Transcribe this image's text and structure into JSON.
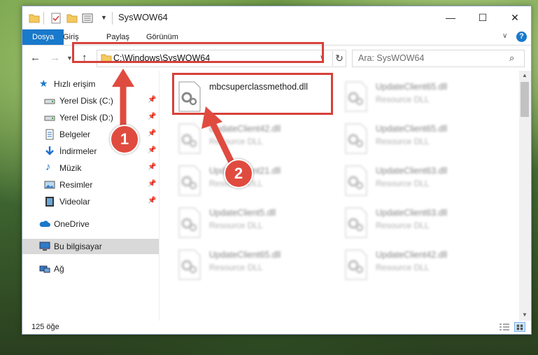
{
  "window": {
    "title": "SysWOW64",
    "minimize_glyph": "—",
    "maximize_glyph": "☐",
    "close_glyph": "✕"
  },
  "ribbon": {
    "tabs": [
      "Dosya",
      "Giriş",
      "Paylaş",
      "Görünüm"
    ],
    "help_glyph": "?"
  },
  "address": {
    "path": "C:\\Windows\\SysWOW64",
    "search_placeholder": "Ara: SysWOW64"
  },
  "nav_pane": {
    "items": [
      {
        "label": "Hızlı erişim",
        "icon": "star-icon",
        "pinned": false
      },
      {
        "label": "Yerel Disk (C:)",
        "icon": "drive-icon",
        "pinned": true
      },
      {
        "label": "Yerel Disk (D:)",
        "icon": "drive-icon",
        "pinned": true
      },
      {
        "label": "Belgeler",
        "icon": "documents-icon",
        "pinned": true
      },
      {
        "label": "İndirmeler",
        "icon": "download-icon",
        "pinned": true
      },
      {
        "label": "Müzik",
        "icon": "music-icon",
        "pinned": true
      },
      {
        "label": "Resimler",
        "icon": "pictures-icon",
        "pinned": true
      },
      {
        "label": "Videolar",
        "icon": "videos-icon",
        "pinned": true
      },
      {
        "label": "OneDrive",
        "icon": "onedrive-icon",
        "pinned": false
      },
      {
        "label": "Bu bilgisayar",
        "icon": "computer-icon",
        "pinned": false,
        "selected": true
      },
      {
        "label": "Ağ",
        "icon": "network-icon",
        "pinned": false
      }
    ]
  },
  "files": [
    {
      "name": "mbcsuperclassmethod.dll",
      "type": "",
      "highlighted": true
    },
    {
      "name": "UpdateClient65.dll",
      "type": "Resource DLL"
    },
    {
      "name": "UpdateClient42.dll",
      "type": "Resource DLL"
    },
    {
      "name": "UpdateClient65.dll",
      "type": "Resource DLL"
    },
    {
      "name": "UpdateClient21.dll",
      "type": "Resource DLL"
    },
    {
      "name": "UpdateClient63.dll",
      "type": "Resource DLL"
    },
    {
      "name": "UpdateClient5.dll",
      "type": "Resource DLL"
    },
    {
      "name": "UpdateClient63.dll",
      "type": "Resource DLL"
    },
    {
      "name": "UpdateClient65.dll",
      "type": "Resource DLL"
    },
    {
      "name": "UpdateClient42.dll",
      "type": "Resource DLL"
    }
  ],
  "status": {
    "item_count": "125 öğe"
  },
  "callouts": [
    {
      "number": "1"
    },
    {
      "number": "2"
    }
  ],
  "colors": {
    "accent_blue": "#1979ca",
    "highlight_red": "#d6413a",
    "badge_red": "#e04b3f",
    "selected_bg": "#d9d9d9"
  }
}
